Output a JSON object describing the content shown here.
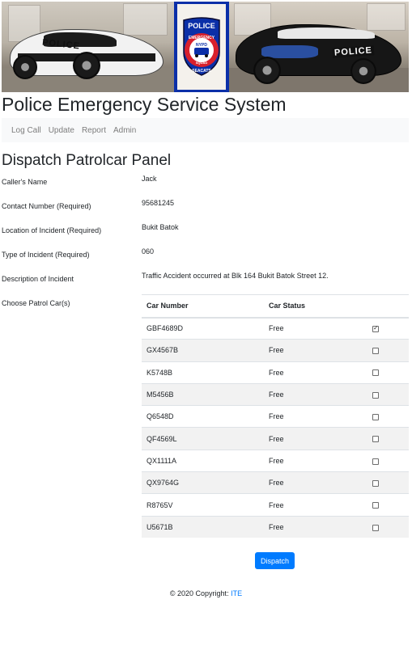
{
  "banner": {
    "left_car_text": "POLICE",
    "right_car_text": "POLICE",
    "badge_top": "POLICE",
    "badge_ring": "EMERGENCY",
    "badge_unit": "NYPD",
    "badge_bottom": "SQUAD",
    "badge_motto": "SEACATS"
  },
  "site_title": "Police Emergency Service System",
  "nav": [
    "Log Call",
    "Update",
    "Report",
    "Admin"
  ],
  "panel_title": "Dispatch Patrolcar Panel",
  "fields": [
    {
      "label": "Caller's Name",
      "value": "Jack"
    },
    {
      "label": "Contact Number (Required)",
      "value": "95681245"
    },
    {
      "label": "Location of Incident (Required)",
      "value": "Bukit Batok"
    },
    {
      "label": "Type of Incident (Required)",
      "value": "060"
    },
    {
      "label": "Description of Incident",
      "value": "Traffic Accident occurred at Blk 164 Bukit Batok Street 12."
    }
  ],
  "choose_label": "Choose Patrol Car(s)",
  "table": {
    "headers": [
      "Car Number",
      "Car Status"
    ],
    "rows": [
      {
        "car": "GBF4689D",
        "status": "Free",
        "checked": true
      },
      {
        "car": "GX4567B",
        "status": "Free",
        "checked": false
      },
      {
        "car": "K5748B",
        "status": "Free",
        "checked": false
      },
      {
        "car": "M5456B",
        "status": "Free",
        "checked": false
      },
      {
        "car": "Q6548D",
        "status": "Free",
        "checked": false
      },
      {
        "car": "QF4569L",
        "status": "Free",
        "checked": false
      },
      {
        "car": "QX1111A",
        "status": "Free",
        "checked": false
      },
      {
        "car": "QX9764G",
        "status": "Free",
        "checked": false
      },
      {
        "car": "R8765V",
        "status": "Free",
        "checked": false
      },
      {
        "car": "U5671B",
        "status": "Free",
        "checked": false
      }
    ]
  },
  "dispatch_label": "Dispatch",
  "footer": {
    "text": "© 2020 Copyright: ",
    "link": "ITE"
  },
  "colors": {
    "primary": "#007bff",
    "badge_blue": "#0b2fa8",
    "badge_red": "#d8202c"
  }
}
